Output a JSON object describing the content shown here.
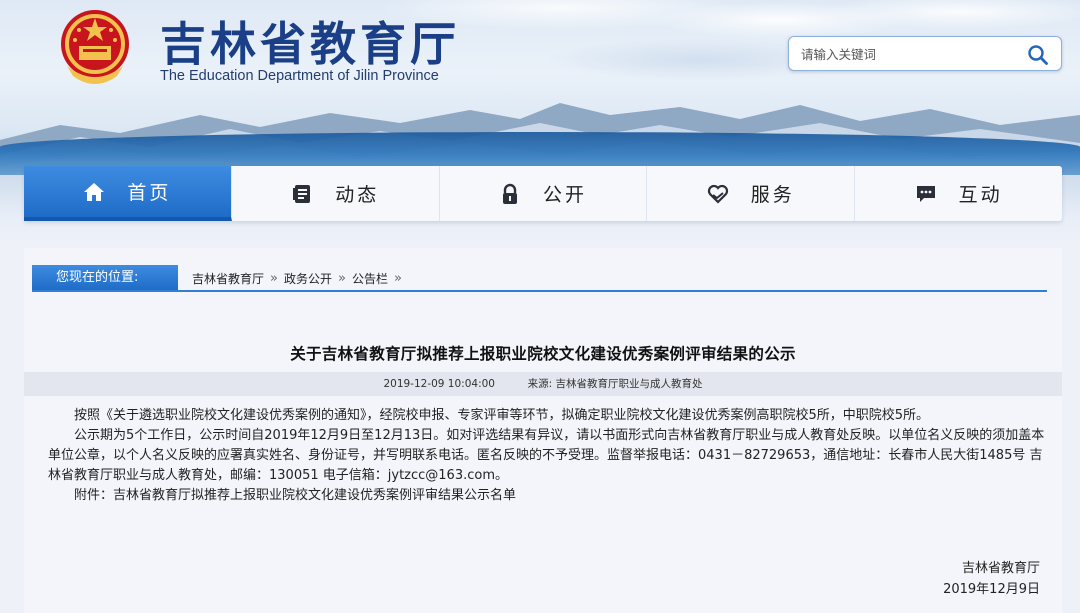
{
  "header": {
    "site_title": "吉林省教育厅",
    "site_subtitle": "The Education Department of Jilin Province",
    "search_placeholder": "请输入关键词"
  },
  "nav": {
    "items": [
      {
        "label": "首页",
        "icon": "home-icon",
        "active": true
      },
      {
        "label": "动态",
        "icon": "document-icon",
        "active": false
      },
      {
        "label": "公开",
        "icon": "lock-icon",
        "active": false
      },
      {
        "label": "服务",
        "icon": "heart-hand-icon",
        "active": false
      },
      {
        "label": "互动",
        "icon": "chat-icon",
        "active": false
      }
    ]
  },
  "breadcrumb": {
    "label": "您现在的位置:",
    "items": [
      "吉林省教育厅",
      "政务公开",
      "公告栏"
    ]
  },
  "article": {
    "title": "关于吉林省教育厅拟推荐上报职业院校文化建设优秀案例评审结果的公示",
    "date": "2019-12-09 10:04:00",
    "source": "来源:   吉林省教育厅职业与成人教育处",
    "paragraphs": [
      "按照《关于遴选职业院校文化建设优秀案例的通知》，经院校申报、专家评审等环节，拟确定职业院校文化建设优秀案例高职院校5所，中职院校5所。",
      "公示期为5个工作日，公示时间自2019年12月9日至12月13日。如对评选结果有异议，请以书面形式向吉林省教育厅职业与成人教育处反映。以单位名义反映的须加盖本单位公章，以个人名义反映的应署真实姓名、身份证号，并写明联系电话。匿名反映的不予受理。监督举报电话：0431－82729653，通信地址：长春市人民大街1485号 吉林省教育厅职业与成人教育处，邮编：130051 电子信箱：jytzcc@163.com。",
      "附件：吉林省教育厅拟推荐上报职业院校文化建设优秀案例评审结果公示名单"
    ],
    "signature_org": "吉林省教育厅",
    "signature_date": "2019年12月9日"
  }
}
